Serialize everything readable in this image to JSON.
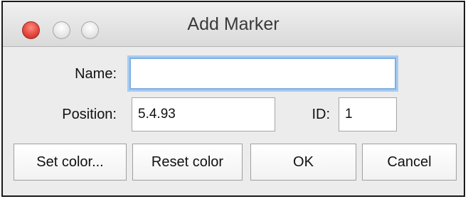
{
  "window": {
    "title": "Add Marker"
  },
  "form": {
    "name_label": "Name:",
    "name_value": "",
    "position_label": "Position:",
    "position_value": "5.4.93",
    "id_label": "ID:",
    "id_value": "1"
  },
  "buttons": {
    "set_color": "Set color...",
    "reset_color": "Reset color",
    "ok": "OK",
    "cancel": "Cancel"
  },
  "colors": {
    "close_light": "#e0443a",
    "focus_ring": "#7fb0e6",
    "window_bg": "#ececec"
  }
}
